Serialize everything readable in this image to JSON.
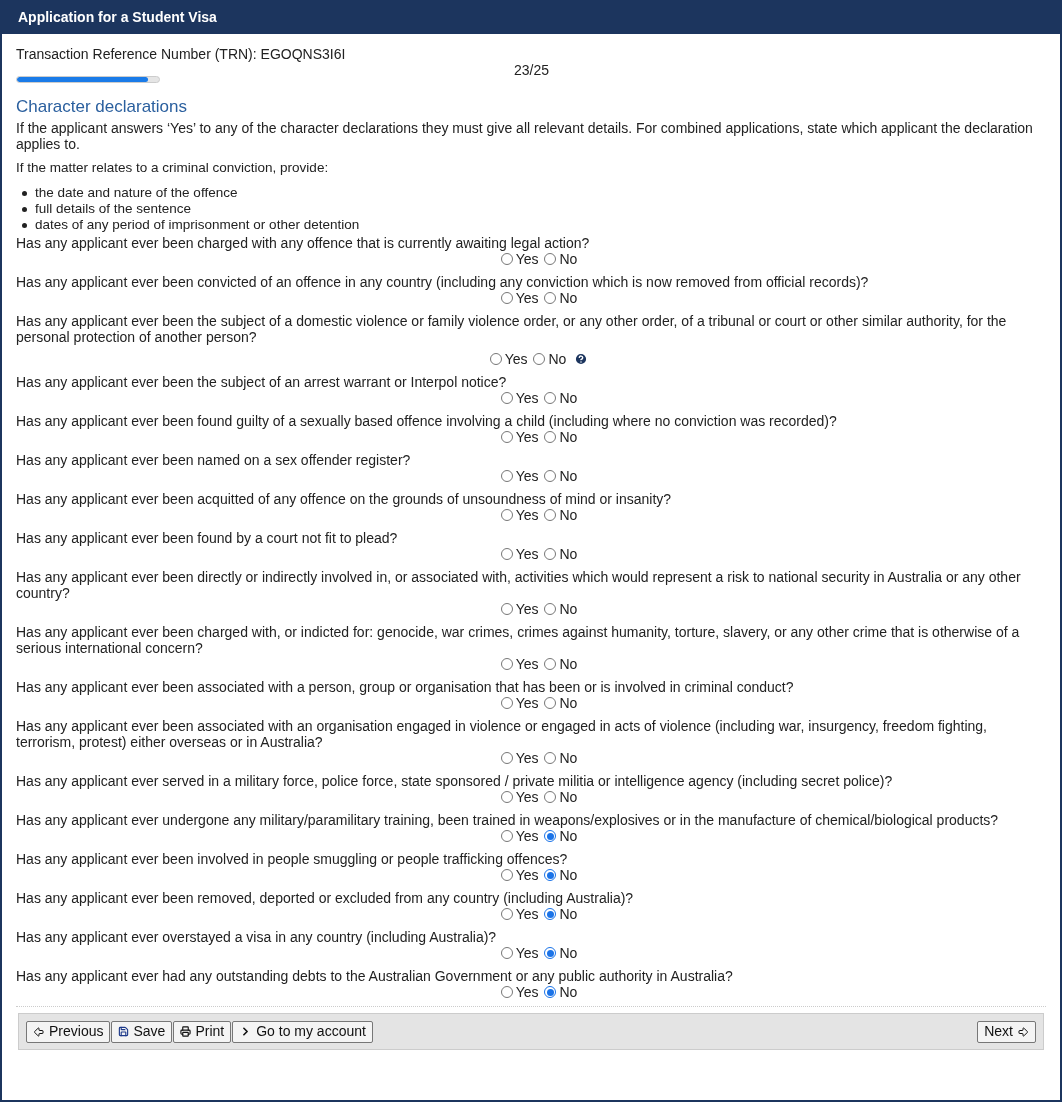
{
  "window": {
    "title": "Application for a Student Visa"
  },
  "trn": "Transaction Reference Number (TRN): EGOQNS3I6I",
  "progress": {
    "step": "23/25",
    "level": 0.92
  },
  "section": {
    "title": "Character declarations",
    "intro": "If the applicant answers ‘Yes’ to any of the character declarations they must give all relevant details. For combined applications, state which applicant the declaration applies to.",
    "conviction_lead": "If the matter relates to a criminal conviction, provide:",
    "bullets": [
      "the date and nature of the offence",
      "full details of the sentence",
      "dates of any period of imprisonment or other detention"
    ]
  },
  "questions": [
    {
      "text": "Has any applicant ever been charged with any offence that is currently awaiting legal action?",
      "help": false,
      "options": [
        {
          "label": "Yes",
          "selected": false
        },
        {
          "label": "No",
          "selected": false
        }
      ]
    },
    {
      "text": "Has any applicant ever been convicted of an offence in any country (including any conviction which is now removed from official records)?",
      "help": false,
      "options": [
        {
          "label": "Yes",
          "selected": false
        },
        {
          "label": "No",
          "selected": false
        }
      ]
    },
    {
      "text": "Has any applicant ever been the subject of a domestic violence or family violence order, or any other order, of a tribunal or court or other similar authority, for the personal protection of another person?",
      "help": true,
      "options": [
        {
          "label": "Yes",
          "selected": false
        },
        {
          "label": "No",
          "selected": false
        }
      ]
    },
    {
      "text": "Has any applicant ever been the subject of an arrest warrant or Interpol notice?",
      "help": false,
      "options": [
        {
          "label": "Yes",
          "selected": false
        },
        {
          "label": "No",
          "selected": false
        }
      ]
    },
    {
      "text": "Has any applicant ever been found guilty of a sexually based offence involving a child (including where no conviction was recorded)?",
      "help": false,
      "options": [
        {
          "label": "Yes",
          "selected": false
        },
        {
          "label": "No",
          "selected": false
        }
      ]
    },
    {
      "text": "Has any applicant ever been named on a sex offender register?",
      "help": false,
      "options": [
        {
          "label": "Yes",
          "selected": false
        },
        {
          "label": "No",
          "selected": false
        }
      ]
    },
    {
      "text": "Has any applicant ever been acquitted of any offence on the grounds of unsoundness of mind or insanity?",
      "help": false,
      "options": [
        {
          "label": "Yes",
          "selected": false
        },
        {
          "label": "No",
          "selected": false
        }
      ]
    },
    {
      "text": "Has any applicant ever been found by a court not fit to plead?",
      "help": false,
      "options": [
        {
          "label": "Yes",
          "selected": false
        },
        {
          "label": "No",
          "selected": false
        }
      ]
    },
    {
      "text": "Has any applicant ever been directly or indirectly involved in, or associated with, activities which would represent a risk to national security in Australia or any other country?",
      "help": false,
      "options": [
        {
          "label": "Yes",
          "selected": false
        },
        {
          "label": "No",
          "selected": false
        }
      ]
    },
    {
      "text": "Has any applicant ever been charged with, or indicted for: genocide, war crimes, crimes against humanity, torture, slavery, or any other crime that is otherwise of a serious international concern?",
      "help": false,
      "options": [
        {
          "label": "Yes",
          "selected": false
        },
        {
          "label": "No",
          "selected": false
        }
      ]
    },
    {
      "text": "Has any applicant ever been associated with a person, group or organisation that has been or is involved in criminal conduct?",
      "help": false,
      "options": [
        {
          "label": "Yes",
          "selected": false
        },
        {
          "label": "No",
          "selected": false
        }
      ]
    },
    {
      "text": "Has any applicant ever been associated with an organisation engaged in violence or engaged in acts of violence (including war, insurgency, freedom fighting, terrorism, protest) either overseas or in Australia?",
      "help": false,
      "options": [
        {
          "label": "Yes",
          "selected": false
        },
        {
          "label": "No",
          "selected": false
        }
      ]
    },
    {
      "text": "Has any applicant ever served in a military force, police force, state sponsored / private militia or intelligence agency (including secret police)?",
      "help": false,
      "options": [
        {
          "label": "Yes",
          "selected": false
        },
        {
          "label": "No",
          "selected": false
        }
      ]
    },
    {
      "text": "Has any applicant ever undergone any military/paramilitary training, been trained in weapons/explosives or in the manufacture of chemical/biological products?",
      "help": false,
      "options": [
        {
          "label": "Yes",
          "selected": false
        },
        {
          "label": "No",
          "selected": true
        }
      ]
    },
    {
      "text": "Has any applicant ever been involved in people smuggling or people trafficking offences?",
      "help": false,
      "options": [
        {
          "label": "Yes",
          "selected": false
        },
        {
          "label": "No",
          "selected": true
        }
      ]
    },
    {
      "text": "Has any applicant ever been removed, deported or excluded from any country (including Australia)?",
      "help": false,
      "options": [
        {
          "label": "Yes",
          "selected": false
        },
        {
          "label": "No",
          "selected": true
        }
      ]
    },
    {
      "text": "Has any applicant ever overstayed a visa in any country (including Australia)?",
      "help": false,
      "options": [
        {
          "label": "Yes",
          "selected": false
        },
        {
          "label": "No",
          "selected": true
        }
      ]
    },
    {
      "text": "Has any applicant ever had any outstanding debts to the Australian Government or any public authority in Australia?",
      "help": false,
      "options": [
        {
          "label": "Yes",
          "selected": false
        },
        {
          "label": "No",
          "selected": true
        }
      ]
    }
  ],
  "footer": {
    "left_buttons": [
      {
        "label": "Previous",
        "kind": "previous"
      },
      {
        "label": "Save",
        "kind": "save"
      },
      {
        "label": "Print",
        "kind": "print"
      },
      {
        "label": "Go to my account",
        "kind": "account"
      }
    ],
    "right_buttons": [
      {
        "label": "Next",
        "kind": "next"
      }
    ]
  }
}
